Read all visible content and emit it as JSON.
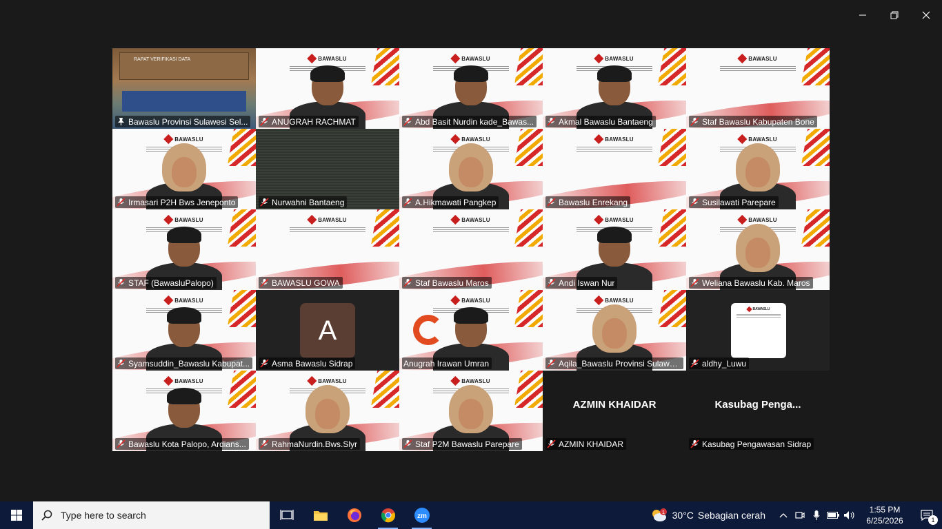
{
  "window": {
    "controls": [
      "minimize",
      "restore",
      "close"
    ]
  },
  "participants": [
    {
      "name": "Bawaslu Provinsi Sulawesi Sel...",
      "mic": "pinned",
      "video": "room",
      "room_text": "RAPAT VERIFIKASI DATA"
    },
    {
      "name": "ANUGRAH RACHMAT",
      "mic": "muted",
      "video": "banner-man"
    },
    {
      "name": "Abd Basit Nurdin kade_Bawas...",
      "mic": "muted",
      "video": "banner-man"
    },
    {
      "name": "Akmal Bawaslu Bantaeng",
      "mic": "muted",
      "video": "banner-man"
    },
    {
      "name": "Staf Bawaslu Kabupaten Bone",
      "mic": "muted",
      "video": "banner"
    },
    {
      "name": "Irmasari P2H Bws Jeneponto",
      "mic": "muted",
      "video": "banner-hijab"
    },
    {
      "name": "Nurwahni Bantaeng",
      "mic": "muted",
      "video": "dark"
    },
    {
      "name": "A.Hikmawati  Pangkep",
      "mic": "muted",
      "video": "banner-hijab"
    },
    {
      "name": "Bawaslu Enrekang",
      "mic": "muted",
      "video": "banner"
    },
    {
      "name": "Susilawati Parepare",
      "mic": "muted",
      "video": "banner-hijab"
    },
    {
      "name": "STAF (BawasluPalopo)",
      "mic": "muted",
      "video": "banner-man"
    },
    {
      "name": "BAWASLU GOWA",
      "mic": "muted",
      "video": "banner"
    },
    {
      "name": "Staf Bawaslu Maros",
      "mic": "muted",
      "video": "banner"
    },
    {
      "name": "Andi Iswan Nur",
      "mic": "muted",
      "video": "banner-man"
    },
    {
      "name": "Weliana Bawaslu Kab. Maros",
      "mic": "muted",
      "video": "banner-hijab"
    },
    {
      "name": "Syamsuddin_Bawaslu Kabupat...",
      "mic": "muted",
      "video": "banner-man"
    },
    {
      "name": "Asma Bawaslu Sidrap",
      "mic": "muted",
      "video": "avatar",
      "avatar_letter": "A"
    },
    {
      "name": "Anugrah Irawan Umran",
      "mic": "none",
      "video": "banner-man-orange"
    },
    {
      "name": "Aqila_Bawaslu Provinsi Sulawe...",
      "mic": "muted",
      "video": "banner-hijab"
    },
    {
      "name": "aldhy_Luwu",
      "mic": "muted",
      "video": "mini-slide"
    },
    {
      "name": "Bawaslu Kota Palopo, Ardians...",
      "mic": "muted",
      "video": "banner-man"
    },
    {
      "name": "RahmaNurdin.Bws.Slyr",
      "mic": "muted",
      "video": "banner-hijab"
    },
    {
      "name": "Staf P2M Bawaslu Parepare",
      "mic": "muted",
      "video": "banner-hijab"
    },
    {
      "name": "AZMIN KHAIDAR",
      "mic": "muted",
      "video": "name-only",
      "display_name": "AZMIN KHAIDAR"
    },
    {
      "name": "Kasubag Pengawasan Sidrap",
      "mic": "muted",
      "video": "name-only",
      "display_name": "Kasubag  Penga..."
    }
  ],
  "banner": {
    "logo_text": "BAWASLU",
    "brand_red": "#c81e1e",
    "brand_gold": "#f2a900"
  },
  "taskbar": {
    "search_placeholder": "Type here to search",
    "apps": [
      "task-view",
      "file-explorer",
      "firefox",
      "chrome",
      "zoom"
    ],
    "zoom_label": "zm",
    "weather": {
      "temp": "30°C",
      "desc": "Sebagian cerah",
      "badge": "1"
    },
    "clock": {
      "time": "1:55 PM",
      "date": "6/25/2026"
    },
    "notifications_badge": "1"
  }
}
